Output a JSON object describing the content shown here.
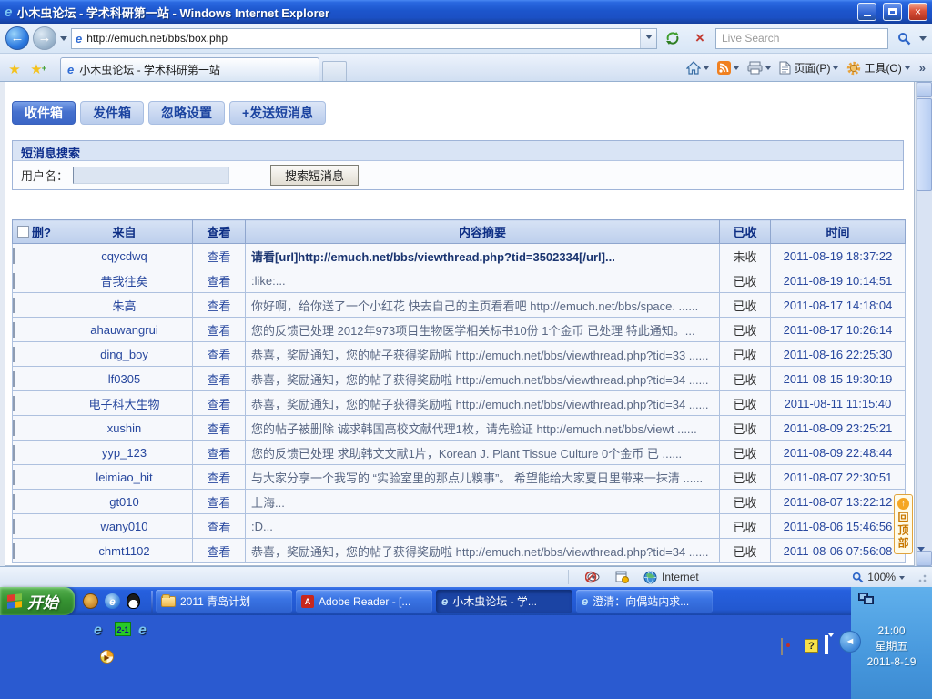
{
  "browser": {
    "window_title": "小木虫论坛 - 学术科研第一站 - Windows Internet Explorer",
    "address": "http://emuch.net/bbs/box.php",
    "search_placeholder": "Live Search",
    "tab_title": "小木虫论坛 - 学术科研第一站",
    "page_menu": "页面(P)",
    "tools_menu": "工具(O)",
    "overflow_chevron": "»"
  },
  "pm": {
    "tabs": {
      "inbox": "收件箱",
      "outbox": "发件箱",
      "ignore": "忽略设置",
      "send": "+发送短消息"
    },
    "search": {
      "title": "短消息搜索",
      "username_label": "用户名：",
      "button": "搜索短消息"
    },
    "table": {
      "headers": {
        "del": "删?",
        "from": "来自",
        "view": "查看",
        "summary": "内容摘要",
        "received": "已收",
        "time": "时间"
      },
      "view_link": "查看",
      "rows": [
        {
          "from": "cqycdwq",
          "summary": "请看[url]http://emuch.net/bbs/viewthread.php?tid=3502334[/url]...",
          "received": "未收",
          "time": "2011-08-19 18:37:22"
        },
        {
          "from": "昔我往矣",
          "summary": ":like:...",
          "received": "已收",
          "time": "2011-08-19 10:14:51"
        },
        {
          "from": "朱高",
          "summary": "你好啊，给你送了一个小红花 快去自己的主页看看吧  http://emuch.net/bbs/space. ......",
          "received": "已收",
          "time": "2011-08-17 14:18:04"
        },
        {
          "from": "ahauwangrui",
          "summary": "您的反馈已处理  2012年973项目生物医学相关标书10份  1个金币  已处理  特此通知。...",
          "received": "已收",
          "time": "2011-08-17 10:26:14"
        },
        {
          "from": "ding_boy",
          "summary": "恭喜，奖励通知，您的帖子获得奖励啦  http://emuch.net/bbs/viewthread.php?tid=33 ......",
          "received": "已收",
          "time": "2011-08-16 22:25:30"
        },
        {
          "from": "lf0305",
          "summary": "恭喜，奖励通知，您的帖子获得奖励啦  http://emuch.net/bbs/viewthread.php?tid=34 ......",
          "received": "已收",
          "time": "2011-08-15 19:30:19"
        },
        {
          "from": "电子科大生物",
          "summary": "恭喜，奖励通知，您的帖子获得奖励啦  http://emuch.net/bbs/viewthread.php?tid=34 ......",
          "received": "已收",
          "time": "2011-08-11 11:15:40"
        },
        {
          "from": "xushin",
          "summary": "您的帖子被删除  诚求韩国高校文献代理1枚，请先验证  http://emuch.net/bbs/viewt ......",
          "received": "已收",
          "time": "2011-08-09 23:25:21"
        },
        {
          "from": "yyp_123",
          "summary": "您的反馈已处理  求助韩文文献1片，Korean J. Plant Tissue Culture 0个金币  已 ......",
          "received": "已收",
          "time": "2011-08-09 22:48:44"
        },
        {
          "from": "leimiao_hit",
          "summary": "与大家分享一个我写的 “实验室里的那点儿糗事”。  希望能给大家夏日里带来一抹清 ......",
          "received": "已收",
          "time": "2011-08-07 22:30:51"
        },
        {
          "from": "gt010",
          "summary": "上海...",
          "received": "已收",
          "time": "2011-08-07 13:22:12"
        },
        {
          "from": "wany010",
          "summary": ":D...",
          "received": "已收",
          "time": "2011-08-06 15:46:56"
        },
        {
          "from": "chmt1102",
          "summary": "恭喜，奖励通知，您的帖子获得奖励啦  http://emuch.net/bbs/viewthread.php?tid=34 ......",
          "received": "已收",
          "time": "2011-08-06 07:56:08"
        }
      ]
    },
    "back_to_top": "回顶部"
  },
  "statusbar": {
    "zone": "Internet",
    "zoom": "100%"
  },
  "taskbar": {
    "start_label": "开始",
    "tasks": [
      {
        "label": "2011 青岛计划"
      },
      {
        "label": "Adobe Reader - [..."
      },
      {
        "label": "小木虫论坛 - 学..."
      },
      {
        "label": "澄清：向偶站内求..."
      }
    ]
  },
  "clock": {
    "time": "21:00",
    "weekday": "星期五",
    "date": "2011-8-19"
  },
  "icons": {
    "ie_logo": "e",
    "favorites_star": "★",
    "add_favorite_plus": "+",
    "back_arrow": "←",
    "forward_arrow": "→",
    "stop": "×",
    "close": "×",
    "up_arrow": "↑",
    "help": "?",
    "collapse_left": "◄",
    "desktop_badge": "2-1",
    "media_play": "▶",
    "adobe_a": "A"
  }
}
